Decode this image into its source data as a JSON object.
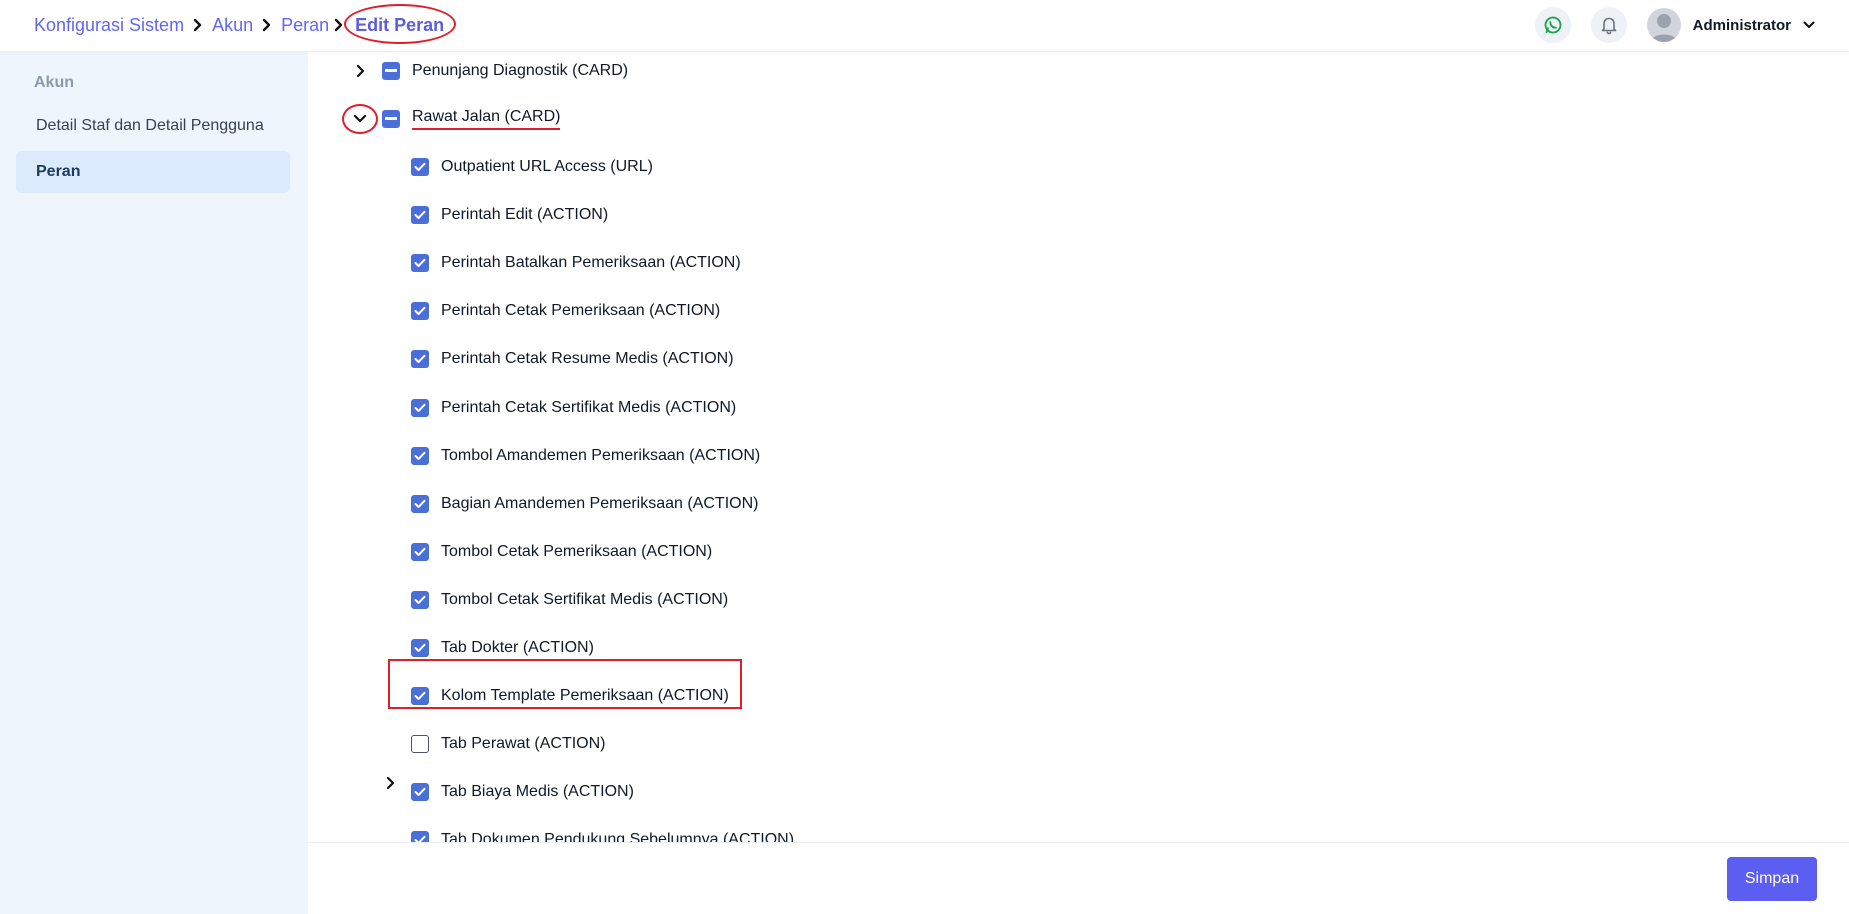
{
  "breadcrumb": {
    "items": [
      "Konfigurasi Sistem",
      "Akun",
      "Peran"
    ],
    "current": "Edit Peran"
  },
  "header": {
    "user_name": "Administrator"
  },
  "sidebar": {
    "section_title": "Akun",
    "items": [
      {
        "label": "Detail Staf dan Detail Pengguna",
        "active": false
      },
      {
        "label": "Peran",
        "active": true
      }
    ]
  },
  "tree": {
    "parents": [
      {
        "label": "Penunjang Diagnostik (CARD)",
        "state": "indeterminate",
        "expanded": false
      },
      {
        "label": "Rawat Jalan (CARD)",
        "state": "indeterminate",
        "expanded": true
      }
    ],
    "children": [
      {
        "label": "Outpatient URL Access (URL)",
        "checked": true
      },
      {
        "label": "Perintah Edit (ACTION)",
        "checked": true
      },
      {
        "label": "Perintah Batalkan Pemeriksaan (ACTION)",
        "checked": true
      },
      {
        "label": "Perintah Cetak Pemeriksaan (ACTION)",
        "checked": true
      },
      {
        "label": "Perintah Cetak Resume Medis (ACTION)",
        "checked": true
      },
      {
        "label": "Perintah Cetak Sertifikat Medis (ACTION)",
        "checked": true
      },
      {
        "label": "Tombol Amandemen Pemeriksaan (ACTION)",
        "checked": true
      },
      {
        "label": "Bagian Amandemen Pemeriksaan (ACTION)",
        "checked": true
      },
      {
        "label": "Tombol Cetak Pemeriksaan (ACTION)",
        "checked": true
      },
      {
        "label": "Tombol Cetak Sertifikat Medis (ACTION)",
        "checked": true
      },
      {
        "label": "Tab Dokter (ACTION)",
        "checked": true
      },
      {
        "label": "Kolom Template Pemeriksaan (ACTION)",
        "checked": true,
        "highlighted": true
      },
      {
        "label": "Tab Perawat (ACTION)",
        "checked": false
      },
      {
        "label": "Tab Biaya Medis (ACTION)",
        "checked": true,
        "has_children": true
      },
      {
        "label": "Tab Dokumen Pendukung Sebelumnya (ACTION)",
        "checked": true
      }
    ]
  },
  "footer": {
    "save_label": "Simpan"
  },
  "colors": {
    "accent": "#5b5ef0",
    "checkbox": "#4a6fd8",
    "annotation": "#e11d2a",
    "sidebar_bg": "#eef5fd"
  }
}
